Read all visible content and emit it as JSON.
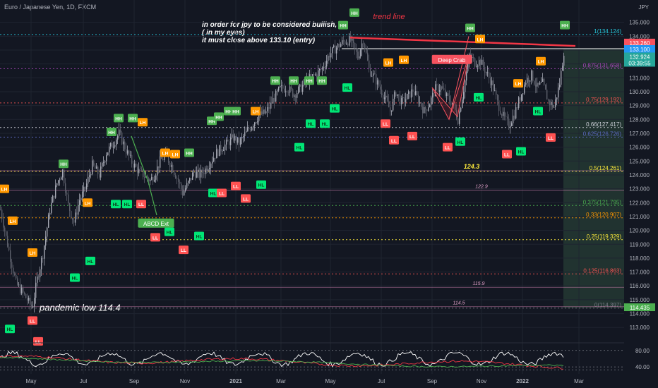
{
  "chart_data": {
    "type": "candlestick",
    "title": "Euro / Japanese Yen, 1D, FXCM",
    "currency": "JPY",
    "ylim": [
      112.3,
      136.0
    ],
    "y_ticks": [
      113.0,
      114.0,
      115.0,
      116.0,
      117.0,
      118.0,
      119.0,
      120.0,
      121.0,
      122.0,
      123.0,
      124.0,
      125.0,
      126.0,
      127.0,
      128.0,
      129.0,
      130.0,
      131.0,
      132.0,
      133.0,
      134.0,
      135.0
    ],
    "x_ticks": [
      "May",
      "Jul",
      "Sep",
      "Nov",
      "2021",
      "Mar",
      "May",
      "Jul",
      "Sep",
      "Nov",
      "2022",
      "Mar"
    ],
    "price_path": [
      [
        0,
        121.5
      ],
      [
        8,
        119.5
      ],
      [
        15,
        117.8
      ],
      [
        22,
        116.2
      ],
      [
        30,
        115.6
      ],
      [
        38,
        115.0
      ],
      [
        45,
        114.4
      ],
      [
        52,
        116.5
      ],
      [
        60,
        118.3
      ],
      [
        70,
        121.5
      ],
      [
        80,
        123.4
      ],
      [
        88,
        124.3
      ],
      [
        96,
        121.8
      ],
      [
        104,
        120.6
      ],
      [
        112,
        122.2
      ],
      [
        120,
        123.0
      ],
      [
        130,
        124.7
      ],
      [
        140,
        124.0
      ],
      [
        150,
        125.6
      ],
      [
        160,
        126.3
      ],
      [
        168,
        127.0
      ],
      [
        176,
        126.0
      ],
      [
        185,
        125.0
      ],
      [
        195,
        124.3
      ],
      [
        205,
        123.9
      ],
      [
        212,
        123.6
      ],
      [
        218,
        124.0
      ],
      [
        226,
        125.0
      ],
      [
        234,
        125.4
      ],
      [
        242,
        124.7
      ],
      [
        250,
        123.8
      ],
      [
        258,
        122.7
      ],
      [
        266,
        123.4
      ],
      [
        274,
        124.2
      ],
      [
        282,
        124.0
      ],
      [
        290,
        124.4
      ],
      [
        298,
        125.0
      ],
      [
        306,
        125.6
      ],
      [
        314,
        126.0
      ],
      [
        322,
        126.3
      ],
      [
        330,
        126.7
      ],
      [
        338,
        126.3
      ],
      [
        346,
        126.9
      ],
      [
        356,
        127.6
      ],
      [
        366,
        128.3
      ],
      [
        376,
        128.5
      ],
      [
        386,
        129.4
      ],
      [
        396,
        130.2
      ],
      [
        406,
        130.3
      ],
      [
        416,
        129.8
      ],
      [
        426,
        130.3
      ],
      [
        436,
        130.9
      ],
      [
        446,
        131.2
      ],
      [
        456,
        131.7
      ],
      [
        466,
        132.7
      ],
      [
        476,
        133.2
      ],
      [
        486,
        133.6
      ],
      [
        496,
        133.7
      ],
      [
        506,
        132.5
      ],
      [
        514,
        133.8
      ],
      [
        522,
        131.6
      ],
      [
        530,
        131.0
      ],
      [
        538,
        130.2
      ],
      [
        546,
        129.4
      ],
      [
        552,
        128.6
      ],
      [
        560,
        130.0
      ],
      [
        568,
        129.2
      ],
      [
        576,
        129.6
      ],
      [
        584,
        130.1
      ],
      [
        592,
        129.4
      ],
      [
        600,
        128.6
      ],
      [
        608,
        129.2
      ],
      [
        616,
        130.2
      ],
      [
        624,
        130.3
      ],
      [
        632,
        129.6
      ],
      [
        640,
        129.2
      ],
      [
        648,
        128.0
      ],
      [
        656,
        130.2
      ],
      [
        664,
        132.6
      ],
      [
        672,
        132.1
      ],
      [
        680,
        132.2
      ],
      [
        688,
        131.4
      ],
      [
        696,
        130.6
      ],
      [
        704,
        129.2
      ],
      [
        712,
        128.2
      ],
      [
        720,
        127.6
      ],
      [
        728,
        128.4
      ],
      [
        736,
        129.6
      ],
      [
        744,
        130.8
      ],
      [
        752,
        131.2
      ],
      [
        760,
        130.3
      ],
      [
        768,
        130.6
      ],
      [
        776,
        129.3
      ],
      [
        784,
        128.9
      ],
      [
        792,
        130.6
      ],
      [
        798,
        132.92
      ]
    ],
    "last_price": 132.924,
    "countdown": "03:39:55",
    "price_tags": [
      {
        "value": 133.26,
        "label": "133.260",
        "color": "#f7525f"
      },
      {
        "value": 133.1,
        "label": "133.100",
        "color": "#2196f3"
      },
      {
        "value": 132.924,
        "label": "132.924",
        "color": "#26a69a"
      },
      {
        "value": 114.435,
        "label": "114.435",
        "color": "#4caf50"
      }
    ],
    "fib_levels": [
      {
        "value": 134.124,
        "label": "1(134.124)",
        "color": "#26c6da"
      },
      {
        "value": 131.658,
        "label": "0.875(131.658)",
        "color": "#ab47bc"
      },
      {
        "value": 129.192,
        "label": "0.75(129.192)",
        "color": "#ef5350"
      },
      {
        "value": 127.417,
        "label": "0.66(127.417)",
        "color": "#d1d4dc"
      },
      {
        "value": 126.726,
        "label": "0.625(126.726)",
        "color": "#5c6bc0"
      },
      {
        "value": 124.261,
        "label": "0.5(124.261)",
        "color": "#ffeb3b"
      },
      {
        "value": 121.795,
        "label": "0.375(121.795)",
        "color": "#4caf50"
      },
      {
        "value": 120.907,
        "label": "0.33(120.907)",
        "color": "#ff9800"
      },
      {
        "value": 119.329,
        "label": "0.25(119.329)",
        "color": "#ffeb3b"
      },
      {
        "value": 116.863,
        "label": "0.125(116.863)",
        "color": "#ef5350"
      },
      {
        "value": 114.397,
        "label": "0(114.397)",
        "color": "#787b86"
      }
    ],
    "horizontal_lines": [
      {
        "value": 124.3,
        "label": "124.3",
        "color": "#ffeb3b"
      },
      {
        "value": 122.9,
        "label": "122.9",
        "color": "#e1a0c8"
      },
      {
        "value": 115.9,
        "label": "115.9",
        "color": "#e1a0c8"
      },
      {
        "value": 114.5,
        "label": "114.5",
        "color": "#e1a0c8"
      }
    ],
    "entry_level": 133.1,
    "trend_line": {
      "label": "trend line",
      "start": [
        496,
        133.9
      ],
      "end": [
        815,
        133.3
      ],
      "color": "#f23645"
    },
    "pivot_markers": [
      {
        "label": "LH",
        "x": 6,
        "value": 123.0,
        "type": "LH"
      },
      {
        "label": "LH",
        "x": 18,
        "value": 120.7,
        "type": "LH"
      },
      {
        "label": "HL",
        "x": 14,
        "value": 112.9,
        "type": "HL"
      },
      {
        "label": "LH",
        "x": 46,
        "value": 118.4,
        "type": "LH"
      },
      {
        "label": "LL",
        "x": 46,
        "value": 113.5,
        "type": "LL"
      },
      {
        "label": "LL",
        "x": 54,
        "value": 112.0,
        "type": "LL"
      },
      {
        "label": "HH",
        "x": 90,
        "value": 124.8,
        "type": "HH"
      },
      {
        "label": "HL",
        "x": 106,
        "value": 116.6,
        "type": "HL"
      },
      {
        "label": "LH",
        "x": 124,
        "value": 122.0,
        "type": "LH"
      },
      {
        "label": "HL",
        "x": 128,
        "value": 117.8,
        "type": "HL"
      },
      {
        "label": "HH",
        "x": 158,
        "value": 127.1,
        "type": "HH"
      },
      {
        "label": "HH",
        "x": 168,
        "value": 128.1,
        "type": "HH"
      },
      {
        "label": "HH",
        "x": 188,
        "value": 128.1,
        "type": "HH"
      },
      {
        "label": "LH",
        "x": 202,
        "value": 127.8,
        "type": "LH"
      },
      {
        "label": "HL",
        "x": 164,
        "value": 121.9,
        "type": "HL"
      },
      {
        "label": "HL",
        "x": 180,
        "value": 121.9,
        "type": "HL"
      },
      {
        "label": "LL",
        "x": 200,
        "value": 121.9,
        "type": "LL"
      },
      {
        "label": "LL",
        "x": 220,
        "value": 119.5,
        "type": "LL"
      },
      {
        "label": "LH",
        "x": 234,
        "value": 125.6,
        "type": "LH"
      },
      {
        "label": "LH",
        "x": 248,
        "value": 125.5,
        "type": "LH"
      },
      {
        "label": "HH",
        "x": 268,
        "value": 125.6,
        "type": "HH"
      },
      {
        "label": "HL",
        "x": 240,
        "value": 119.9,
        "type": "HL"
      },
      {
        "label": "HL",
        "x": 282,
        "value": 119.6,
        "type": "HL"
      },
      {
        "label": "LL",
        "x": 260,
        "value": 118.6,
        "type": "LL"
      },
      {
        "label": "HH",
        "x": 300,
        "value": 127.9,
        "type": "HH"
      },
      {
        "label": "HH",
        "x": 310,
        "value": 128.2,
        "type": "HH"
      },
      {
        "label": "HH",
        "x": 324,
        "value": 128.6,
        "type": "HH"
      },
      {
        "label": "HH",
        "x": 334,
        "value": 128.6,
        "type": "HH"
      },
      {
        "label": "LH",
        "x": 362,
        "value": 128.6,
        "type": "LH"
      },
      {
        "label": "HL",
        "x": 302,
        "value": 122.7,
        "type": "HL"
      },
      {
        "label": "LL",
        "x": 314,
        "value": 122.7,
        "type": "LL"
      },
      {
        "label": "LL",
        "x": 334,
        "value": 123.2,
        "type": "LL"
      },
      {
        "label": "LL",
        "x": 348,
        "value": 122.3,
        "type": "LL"
      },
      {
        "label": "HL",
        "x": 370,
        "value": 123.3,
        "type": "HL"
      },
      {
        "label": "HH",
        "x": 390,
        "value": 130.8,
        "type": "HH"
      },
      {
        "label": "HH",
        "x": 416,
        "value": 130.8,
        "type": "HH"
      },
      {
        "label": "HH",
        "x": 438,
        "value": 130.8,
        "type": "HH"
      },
      {
        "label": "HH",
        "x": 456,
        "value": 130.8,
        "type": "HH"
      },
      {
        "label": "HL",
        "x": 424,
        "value": 126.0,
        "type": "HL"
      },
      {
        "label": "HL",
        "x": 440,
        "value": 127.7,
        "type": "HL"
      },
      {
        "label": "HL",
        "x": 460,
        "value": 127.7,
        "type": "HL"
      },
      {
        "label": "HL",
        "x": 474,
        "value": 128.8,
        "type": "HL"
      },
      {
        "label": "HH",
        "x": 486,
        "value": 134.8,
        "type": "HH"
      },
      {
        "label": "HH",
        "x": 502,
        "value": 135.7,
        "type": "HH"
      },
      {
        "label": "HL",
        "x": 492,
        "value": 130.3,
        "type": "HL"
      },
      {
        "label": "LL",
        "x": 546,
        "value": 127.7,
        "type": "LL"
      },
      {
        "label": "LH",
        "x": 550,
        "value": 132.1,
        "type": "LH"
      },
      {
        "label": "LH",
        "x": 572,
        "value": 132.3,
        "type": "LH"
      },
      {
        "label": "LL",
        "x": 558,
        "value": 126.5,
        "type": "LL"
      },
      {
        "label": "LL",
        "x": 584,
        "value": 126.8,
        "type": "LL"
      },
      {
        "label": "LL",
        "x": 634,
        "value": 126.0,
        "type": "LL"
      },
      {
        "label": "HL",
        "x": 652,
        "value": 126.4,
        "type": "HL"
      },
      {
        "label": "HH",
        "x": 666,
        "value": 134.6,
        "type": "HH"
      },
      {
        "label": "LH",
        "x": 680,
        "value": 133.8,
        "type": "LH"
      },
      {
        "label": "HL",
        "x": 678,
        "value": 129.6,
        "type": "HL"
      },
      {
        "label": "LH",
        "x": 734,
        "value": 130.6,
        "type": "LH"
      },
      {
        "label": "LL",
        "x": 718,
        "value": 125.5,
        "type": "LL"
      },
      {
        "label": "HL",
        "x": 738,
        "value": 125.7,
        "type": "HL"
      },
      {
        "label": "HL",
        "x": 762,
        "value": 128.6,
        "type": "HL"
      },
      {
        "label": "LH",
        "x": 766,
        "value": 132.2,
        "type": "LH"
      },
      {
        "label": "LL",
        "x": 780,
        "value": 126.7,
        "type": "LL"
      },
      {
        "label": "HH",
        "x": 800,
        "value": 134.8,
        "type": "HH"
      }
    ],
    "pattern_labels": [
      {
        "label": "ABCD Ext",
        "x": 221,
        "value": 120.5,
        "color": "#4caf50"
      },
      {
        "label": "Deep Crab",
        "x": 640,
        "value": 132.3,
        "color": "#f7525f"
      }
    ],
    "annotations": [
      "in order for jpy to be considered bullish,",
      "( in my eyes)",
      "it must close above 133.10  (entry)"
    ],
    "big_label": "pandemic low 114.4",
    "oscillator": {
      "ylim": [
        30,
        95
      ],
      "ticks": [
        {
          "value": 80,
          "label": "80.00"
        },
        {
          "value": 40,
          "label": "40.00"
        }
      ]
    }
  }
}
